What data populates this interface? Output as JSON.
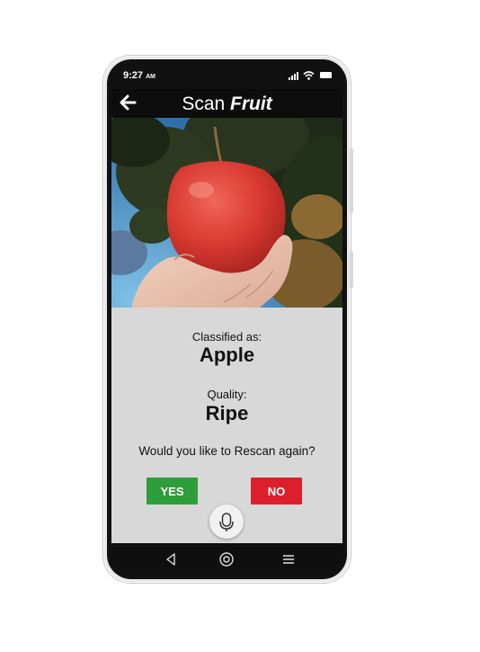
{
  "status_bar": {
    "time": "9:27",
    "ampm": "AM"
  },
  "header": {
    "title_light": "Scan ",
    "title_bold": "Fruit"
  },
  "result": {
    "classified_label": "Classified as:",
    "classified_value": "Apple",
    "quality_label": "Quality:",
    "quality_value": "Ripe",
    "prompt": "Would you like to Rescan again?"
  },
  "buttons": {
    "yes_label": "YES",
    "no_label": "NO"
  },
  "colors": {
    "yes": "#2e9e3b",
    "no": "#dc1f2d",
    "content_bg": "#d8d8d8",
    "header_bg": "#0d0d0d"
  },
  "icons": {
    "back": "back-arrow-icon",
    "mic": "microphone-icon",
    "nav_back": "triangle-back-icon",
    "nav_home": "circle-home-icon",
    "nav_menu": "menu-lines-icon",
    "status": [
      "signal-icon",
      "wifi-icon",
      "battery-icon"
    ]
  }
}
